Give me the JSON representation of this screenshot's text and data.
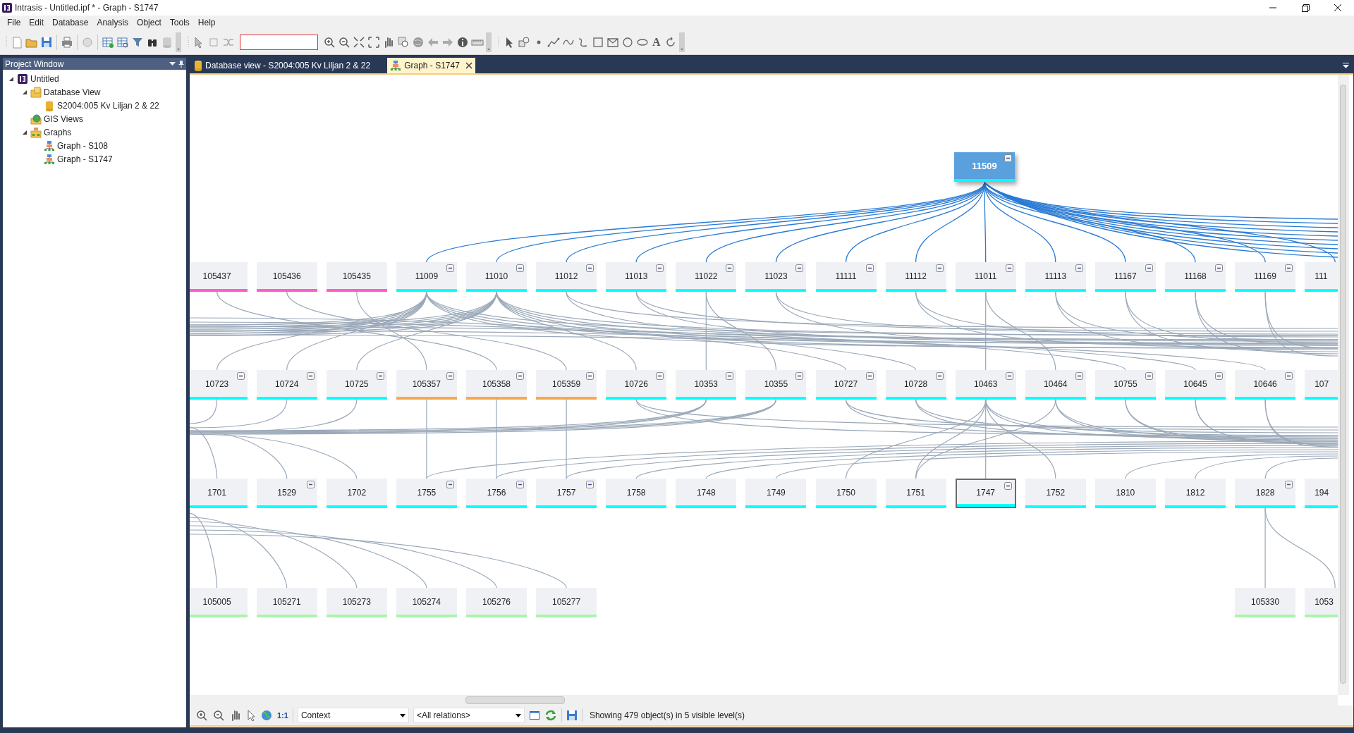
{
  "window": {
    "title": "Intrasis - Untitled.ipf * - Graph - S1747"
  },
  "menu": [
    "File",
    "Edit",
    "Database",
    "Analysis",
    "Object",
    "Tools",
    "Help"
  ],
  "toolbar": {
    "text_tool": "A"
  },
  "project_window": {
    "title": "Project Window",
    "tree": [
      {
        "label": "Untitled",
        "kind": "project",
        "expanded": true,
        "children": [
          {
            "label": "Database View",
            "kind": "folder",
            "expanded": true,
            "children": [
              {
                "label": "S2004:005 Kv Liljan 2 & 22",
                "kind": "database"
              }
            ]
          },
          {
            "label": "GIS Views",
            "kind": "gis"
          },
          {
            "label": "Graphs",
            "kind": "graphs",
            "expanded": true,
            "children": [
              {
                "label": "Graph - S108",
                "kind": "graph"
              },
              {
                "label": "Graph - S1747",
                "kind": "graph"
              }
            ]
          }
        ]
      }
    ]
  },
  "tabs": [
    {
      "label": "Database view - S2004:005 Kv Liljan 2 & 22",
      "kind": "database",
      "selected": false
    },
    {
      "label": "Graph - S1747",
      "kind": "graph",
      "selected": true
    }
  ],
  "graph": {
    "root": {
      "label": "11509",
      "color": "#00ffff",
      "collapsible": true
    },
    "levels": [
      [
        {
          "label": "105437",
          "color": "#ff5ccd",
          "collapsible": false,
          "selected": false
        },
        {
          "label": "105436",
          "color": "#ff5ccd",
          "collapsible": false,
          "selected": false
        },
        {
          "label": "105435",
          "color": "#ff5ccd",
          "collapsible": false,
          "selected": false
        },
        {
          "label": "11009",
          "color": "#00ffff",
          "collapsible": true,
          "selected": false
        },
        {
          "label": "11010",
          "color": "#00ffff",
          "collapsible": true,
          "selected": false
        },
        {
          "label": "11012",
          "color": "#00ffff",
          "collapsible": true,
          "selected": false
        },
        {
          "label": "11013",
          "color": "#00ffff",
          "collapsible": true,
          "selected": false
        },
        {
          "label": "11022",
          "color": "#00ffff",
          "collapsible": true,
          "selected": false
        },
        {
          "label": "11023",
          "color": "#00ffff",
          "collapsible": true,
          "selected": false
        },
        {
          "label": "11111",
          "color": "#00ffff",
          "collapsible": true,
          "selected": false
        },
        {
          "label": "11112",
          "color": "#00ffff",
          "collapsible": true,
          "selected": false
        },
        {
          "label": "11011",
          "color": "#00ffff",
          "collapsible": true,
          "selected": false
        },
        {
          "label": "11113",
          "color": "#00ffff",
          "collapsible": true,
          "selected": false
        },
        {
          "label": "11167",
          "color": "#00ffff",
          "collapsible": true,
          "selected": false
        },
        {
          "label": "11168",
          "color": "#00ffff",
          "collapsible": true,
          "selected": false
        },
        {
          "label": "11169",
          "color": "#00ffff",
          "collapsible": true,
          "selected": false
        },
        {
          "label": "111",
          "color": "#00ffff",
          "collapsible": false,
          "selected": false
        }
      ],
      [
        {
          "label": "10723",
          "color": "#00ffff",
          "collapsible": true,
          "selected": false
        },
        {
          "label": "10724",
          "color": "#00ffff",
          "collapsible": true,
          "selected": false
        },
        {
          "label": "10725",
          "color": "#00ffff",
          "collapsible": true,
          "selected": false
        },
        {
          "label": "105357",
          "color": "#f9a94a",
          "collapsible": true,
          "selected": false
        },
        {
          "label": "105358",
          "color": "#f9a94a",
          "collapsible": true,
          "selected": false
        },
        {
          "label": "105359",
          "color": "#f9a94a",
          "collapsible": true,
          "selected": false
        },
        {
          "label": "10726",
          "color": "#00ffff",
          "collapsible": true,
          "selected": false
        },
        {
          "label": "10353",
          "color": "#00ffff",
          "collapsible": true,
          "selected": false
        },
        {
          "label": "10355",
          "color": "#00ffff",
          "collapsible": true,
          "selected": false
        },
        {
          "label": "10727",
          "color": "#00ffff",
          "collapsible": true,
          "selected": false
        },
        {
          "label": "10728",
          "color": "#00ffff",
          "collapsible": true,
          "selected": false
        },
        {
          "label": "10463",
          "color": "#00ffff",
          "collapsible": true,
          "selected": false
        },
        {
          "label": "10464",
          "color": "#00ffff",
          "collapsible": true,
          "selected": false
        },
        {
          "label": "10755",
          "color": "#00ffff",
          "collapsible": true,
          "selected": false
        },
        {
          "label": "10645",
          "color": "#00ffff",
          "collapsible": true,
          "selected": false
        },
        {
          "label": "10646",
          "color": "#00ffff",
          "collapsible": true,
          "selected": false
        },
        {
          "label": "107",
          "color": "#00ffff",
          "collapsible": false,
          "selected": false
        }
      ],
      [
        {
          "label": "1701",
          "color": "#00ffff",
          "collapsible": false,
          "selected": false
        },
        {
          "label": "1529",
          "color": "#00ffff",
          "collapsible": true,
          "selected": false
        },
        {
          "label": "1702",
          "color": "#00ffff",
          "collapsible": false,
          "selected": false
        },
        {
          "label": "1755",
          "color": "#00ffff",
          "collapsible": true,
          "selected": false
        },
        {
          "label": "1756",
          "color": "#00ffff",
          "collapsible": true,
          "selected": false
        },
        {
          "label": "1757",
          "color": "#00ffff",
          "collapsible": true,
          "selected": false
        },
        {
          "label": "1758",
          "color": "#00ffff",
          "collapsible": false,
          "selected": false
        },
        {
          "label": "1748",
          "color": "#00ffff",
          "collapsible": false,
          "selected": false
        },
        {
          "label": "1749",
          "color": "#00ffff",
          "collapsible": false,
          "selected": false
        },
        {
          "label": "1750",
          "color": "#00ffff",
          "collapsible": false,
          "selected": false
        },
        {
          "label": "1751",
          "color": "#00ffff",
          "collapsible": false,
          "selected": false
        },
        {
          "label": "1747",
          "color": "#00ffff",
          "collapsible": true,
          "selected": true
        },
        {
          "label": "1752",
          "color": "#00ffff",
          "collapsible": false,
          "selected": false
        },
        {
          "label": "1810",
          "color": "#00ffff",
          "collapsible": false,
          "selected": false
        },
        {
          "label": "1812",
          "color": "#00ffff",
          "collapsible": false,
          "selected": false
        },
        {
          "label": "1828",
          "color": "#00ffff",
          "collapsible": true,
          "selected": false
        },
        {
          "label": "194",
          "color": "#00ffff",
          "collapsible": false,
          "selected": false
        }
      ],
      [
        {
          "label": "105005",
          "color": "#a8f5a8",
          "collapsible": false,
          "selected": false
        },
        {
          "label": "105271",
          "color": "#a8f5a8",
          "collapsible": false,
          "selected": false
        },
        {
          "label": "105273",
          "color": "#a8f5a8",
          "collapsible": false,
          "selected": false
        },
        {
          "label": "105274",
          "color": "#a8f5a8",
          "collapsible": false,
          "selected": false
        },
        {
          "label": "105276",
          "color": "#a8f5a8",
          "collapsible": false,
          "selected": false
        },
        {
          "label": "105277",
          "color": "#a8f5a8",
          "collapsible": false,
          "selected": false
        },
        {
          "label": "105330",
          "color": "#a8f5a8",
          "collapsible": false,
          "selected": false
        },
        {
          "label": "1053",
          "color": "#a8f5a8",
          "collapsible": false,
          "selected": false
        }
      ]
    ]
  },
  "bottom_toolbar": {
    "zoom_label": "1:1",
    "view_mode": "Context",
    "relation_filter": "<All relations>",
    "status": "Showing 479 object(s) in 5 visible level(s)"
  }
}
